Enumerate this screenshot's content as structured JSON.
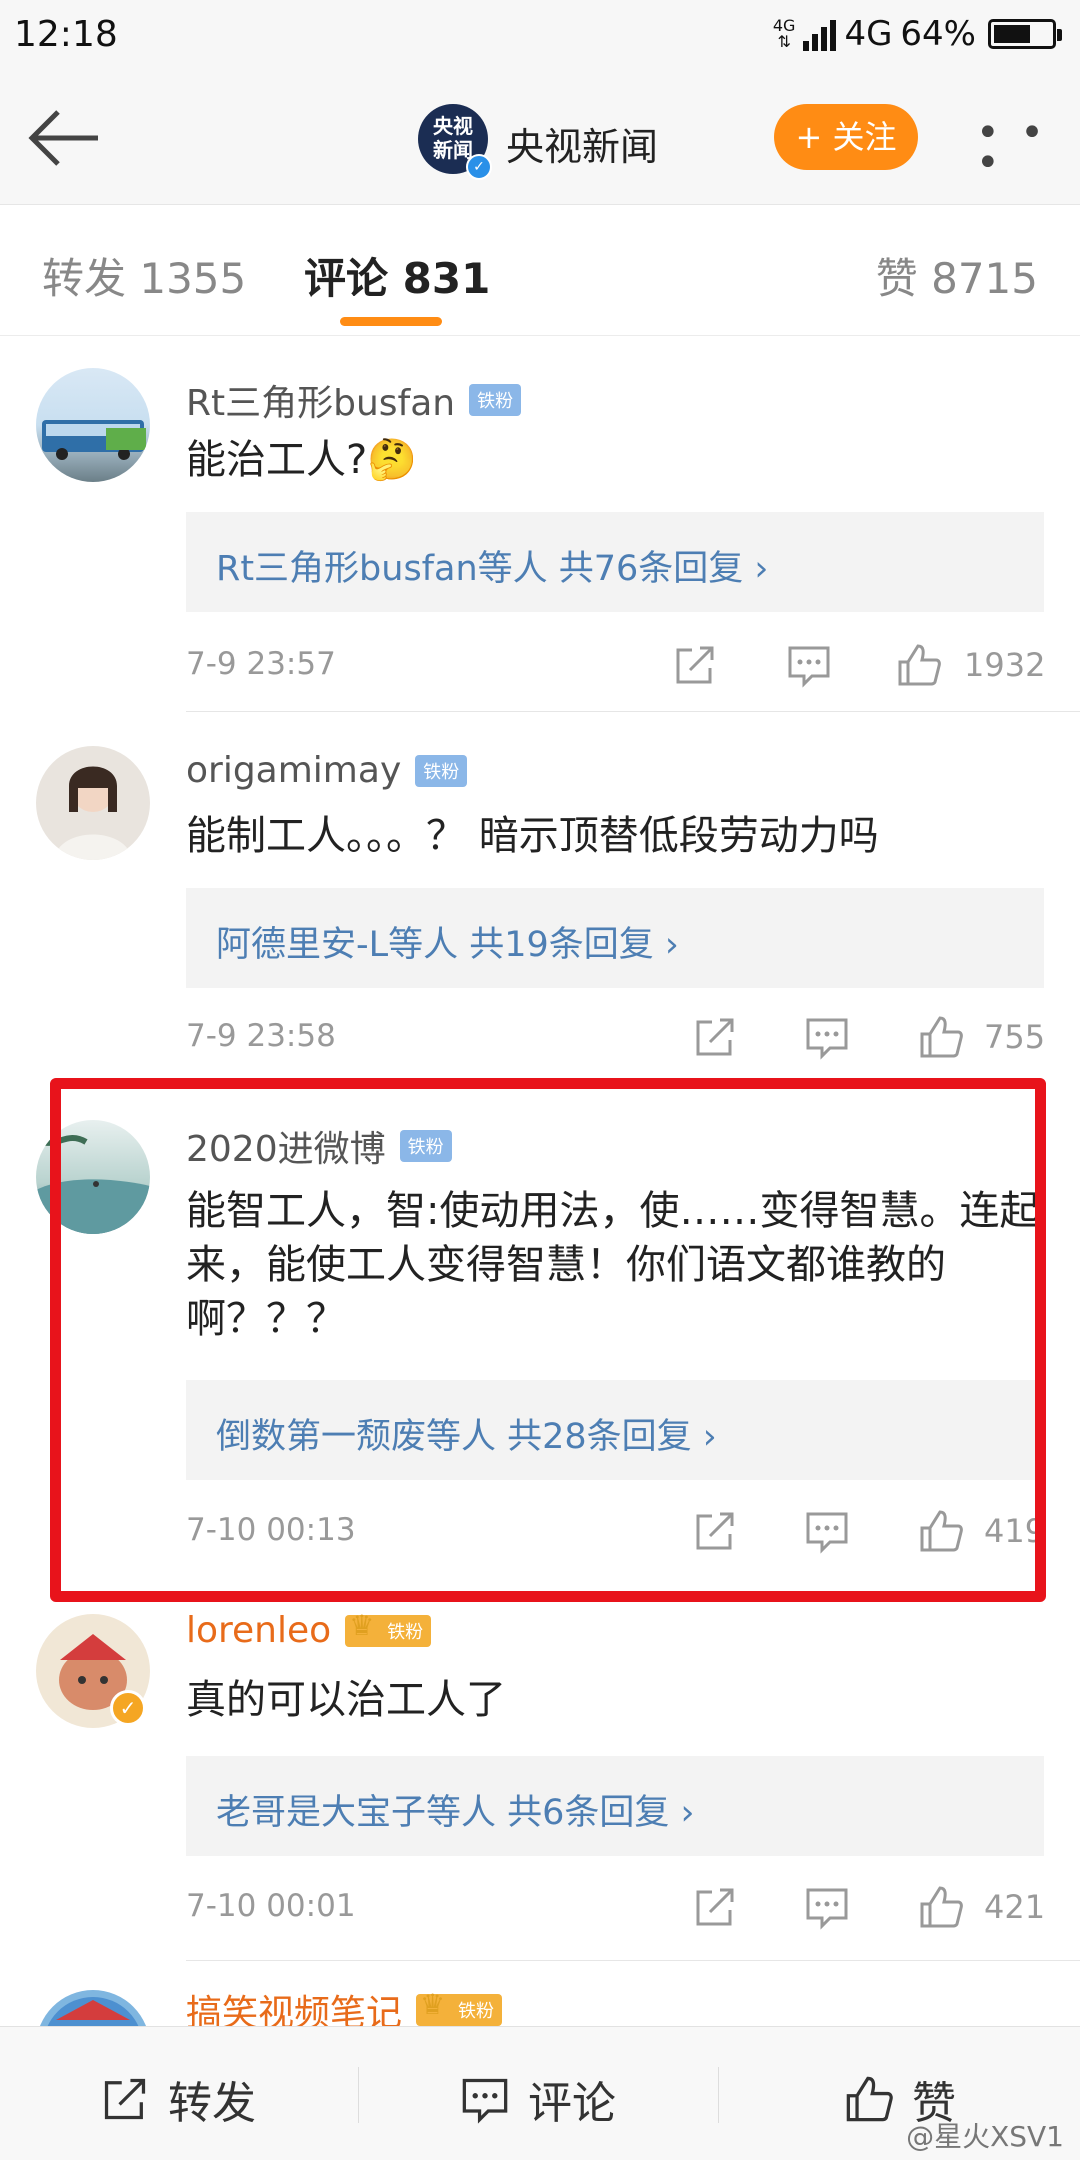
{
  "status_bar": {
    "time": "12:18",
    "network_small": "4G",
    "network": "4G",
    "battery": "64%",
    "battery_level": 0.64
  },
  "header": {
    "account_logo_text": "央视新闻",
    "title": "央视新闻",
    "follow_label": "+ 关注",
    "more_label": "• • •"
  },
  "tabs": {
    "repost": "转发 1355",
    "comments": "评论 831",
    "likes": "赞 8715"
  },
  "comments": [
    {
      "user": "Rt三角形busfan",
      "badge": "铁粉",
      "text": "能治工人?🤔",
      "reply_summary": "Rt三角形busfan等人  共76条回复 ›",
      "time": "7-9 23:57",
      "likes": "1932"
    },
    {
      "user": "origamimay",
      "badge": "铁粉",
      "text": "能制工人。。。？ 暗示顶替低段劳动力吗",
      "reply_summary": "阿德里安-L等人  共19条回复 ›",
      "time": "7-9 23:58",
      "likes": "755"
    },
    {
      "user": "2020进微博",
      "badge": "铁粉",
      "text": "能智工人，智:使动用法，使……变得智慧。连起来，能使工人变得智慧！你们语文都谁教的啊？？？",
      "reply_summary": "倒数第一颓废等人  共28条回复 ›",
      "time": "7-10 00:13",
      "likes": "419"
    },
    {
      "user": "lorenleo",
      "badge": "铁粉",
      "text": "真的可以治工人了",
      "reply_summary": "老哥是大宝子等人  共6条回复 ›",
      "time": "7-10 00:01",
      "likes": "421"
    },
    {
      "user": "搞笑视频笔记",
      "badge": "铁粉"
    }
  ],
  "bottom_bar": {
    "repost": "转发",
    "comment": "评论",
    "like": "赞",
    "watermark": "@星火XSV1"
  },
  "colors": {
    "accent": "#ff8c14",
    "link": "#4d7eb3",
    "highlight": "#e8131b"
  }
}
